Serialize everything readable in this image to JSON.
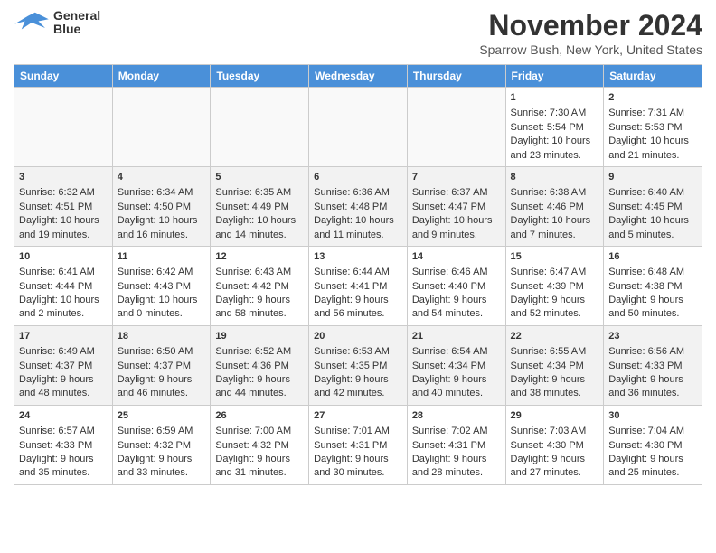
{
  "header": {
    "logo_line1": "General",
    "logo_line2": "Blue",
    "month": "November 2024",
    "location": "Sparrow Bush, New York, United States"
  },
  "days_of_week": [
    "Sunday",
    "Monday",
    "Tuesday",
    "Wednesday",
    "Thursday",
    "Friday",
    "Saturday"
  ],
  "weeks": [
    [
      {
        "day": "",
        "data": ""
      },
      {
        "day": "",
        "data": ""
      },
      {
        "day": "",
        "data": ""
      },
      {
        "day": "",
        "data": ""
      },
      {
        "day": "",
        "data": ""
      },
      {
        "day": "1",
        "data": "Sunrise: 7:30 AM\nSunset: 5:54 PM\nDaylight: 10 hours and 23 minutes."
      },
      {
        "day": "2",
        "data": "Sunrise: 7:31 AM\nSunset: 5:53 PM\nDaylight: 10 hours and 21 minutes."
      }
    ],
    [
      {
        "day": "3",
        "data": "Sunrise: 6:32 AM\nSunset: 4:51 PM\nDaylight: 10 hours and 19 minutes."
      },
      {
        "day": "4",
        "data": "Sunrise: 6:34 AM\nSunset: 4:50 PM\nDaylight: 10 hours and 16 minutes."
      },
      {
        "day": "5",
        "data": "Sunrise: 6:35 AM\nSunset: 4:49 PM\nDaylight: 10 hours and 14 minutes."
      },
      {
        "day": "6",
        "data": "Sunrise: 6:36 AM\nSunset: 4:48 PM\nDaylight: 10 hours and 11 minutes."
      },
      {
        "day": "7",
        "data": "Sunrise: 6:37 AM\nSunset: 4:47 PM\nDaylight: 10 hours and 9 minutes."
      },
      {
        "day": "8",
        "data": "Sunrise: 6:38 AM\nSunset: 4:46 PM\nDaylight: 10 hours and 7 minutes."
      },
      {
        "day": "9",
        "data": "Sunrise: 6:40 AM\nSunset: 4:45 PM\nDaylight: 10 hours and 5 minutes."
      }
    ],
    [
      {
        "day": "10",
        "data": "Sunrise: 6:41 AM\nSunset: 4:44 PM\nDaylight: 10 hours and 2 minutes."
      },
      {
        "day": "11",
        "data": "Sunrise: 6:42 AM\nSunset: 4:43 PM\nDaylight: 10 hours and 0 minutes."
      },
      {
        "day": "12",
        "data": "Sunrise: 6:43 AM\nSunset: 4:42 PM\nDaylight: 9 hours and 58 minutes."
      },
      {
        "day": "13",
        "data": "Sunrise: 6:44 AM\nSunset: 4:41 PM\nDaylight: 9 hours and 56 minutes."
      },
      {
        "day": "14",
        "data": "Sunrise: 6:46 AM\nSunset: 4:40 PM\nDaylight: 9 hours and 54 minutes."
      },
      {
        "day": "15",
        "data": "Sunrise: 6:47 AM\nSunset: 4:39 PM\nDaylight: 9 hours and 52 minutes."
      },
      {
        "day": "16",
        "data": "Sunrise: 6:48 AM\nSunset: 4:38 PM\nDaylight: 9 hours and 50 minutes."
      }
    ],
    [
      {
        "day": "17",
        "data": "Sunrise: 6:49 AM\nSunset: 4:37 PM\nDaylight: 9 hours and 48 minutes."
      },
      {
        "day": "18",
        "data": "Sunrise: 6:50 AM\nSunset: 4:37 PM\nDaylight: 9 hours and 46 minutes."
      },
      {
        "day": "19",
        "data": "Sunrise: 6:52 AM\nSunset: 4:36 PM\nDaylight: 9 hours and 44 minutes."
      },
      {
        "day": "20",
        "data": "Sunrise: 6:53 AM\nSunset: 4:35 PM\nDaylight: 9 hours and 42 minutes."
      },
      {
        "day": "21",
        "data": "Sunrise: 6:54 AM\nSunset: 4:34 PM\nDaylight: 9 hours and 40 minutes."
      },
      {
        "day": "22",
        "data": "Sunrise: 6:55 AM\nSunset: 4:34 PM\nDaylight: 9 hours and 38 minutes."
      },
      {
        "day": "23",
        "data": "Sunrise: 6:56 AM\nSunset: 4:33 PM\nDaylight: 9 hours and 36 minutes."
      }
    ],
    [
      {
        "day": "24",
        "data": "Sunrise: 6:57 AM\nSunset: 4:33 PM\nDaylight: 9 hours and 35 minutes."
      },
      {
        "day": "25",
        "data": "Sunrise: 6:59 AM\nSunset: 4:32 PM\nDaylight: 9 hours and 33 minutes."
      },
      {
        "day": "26",
        "data": "Sunrise: 7:00 AM\nSunset: 4:32 PM\nDaylight: 9 hours and 31 minutes."
      },
      {
        "day": "27",
        "data": "Sunrise: 7:01 AM\nSunset: 4:31 PM\nDaylight: 9 hours and 30 minutes."
      },
      {
        "day": "28",
        "data": "Sunrise: 7:02 AM\nSunset: 4:31 PM\nDaylight: 9 hours and 28 minutes."
      },
      {
        "day": "29",
        "data": "Sunrise: 7:03 AM\nSunset: 4:30 PM\nDaylight: 9 hours and 27 minutes."
      },
      {
        "day": "30",
        "data": "Sunrise: 7:04 AM\nSunset: 4:30 PM\nDaylight: 9 hours and 25 minutes."
      }
    ]
  ]
}
